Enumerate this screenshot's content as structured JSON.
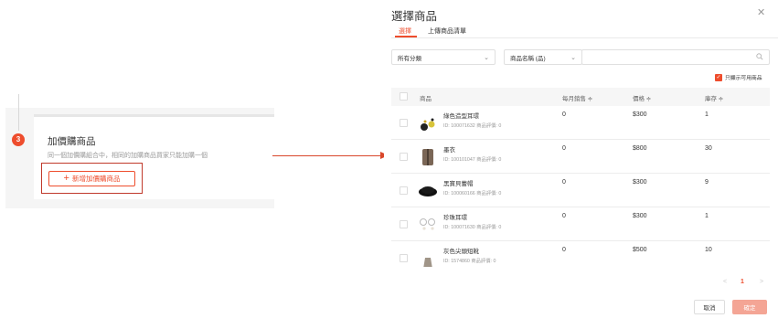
{
  "left_panel": {
    "step_number": "3",
    "title": "加價購商品",
    "description": "同一個加價購組合中，相同的加購商品買家只能加購一個",
    "add_button": {
      "icon": "plus-icon",
      "label": "新增加價購商品"
    }
  },
  "colors": {
    "accent": "#ee4d2d",
    "annotation": "#c0392b",
    "ok_disabled": "#f4a595"
  },
  "modal": {
    "title": "選擇商品",
    "close_icon": "close-icon",
    "tabs": [
      {
        "label": "選擇",
        "active": true
      },
      {
        "label": "上傳商品清單",
        "active": false
      }
    ],
    "filters": {
      "category": "所有分類",
      "search_field": "商品名稱 (品)",
      "search_icon": "search-icon"
    },
    "only_available": {
      "label": "只顯示可用商品",
      "checked": true
    },
    "table": {
      "headers": {
        "product": "商品",
        "monthly_sales": "每月銷售 ≑",
        "price": "價格 ≑",
        "stock": "庫存 ≑"
      },
      "rows": [
        {
          "name": "綠色造型耳環",
          "meta": "ID: 100071632   商品評價: 0",
          "monthly_sales": "0",
          "price": "$300",
          "stock": "1"
        },
        {
          "name": "墨衣",
          "meta": "ID: 100101047   商品評價: 0",
          "monthly_sales": "0",
          "price": "$800",
          "stock": "30"
        },
        {
          "name": "黑寶貝蕾帽",
          "meta": "ID: 100060166   商品評價: 0",
          "monthly_sales": "0",
          "price": "$300",
          "stock": "9"
        },
        {
          "name": "珍珠耳環",
          "meta": "ID: 100071630   商品評價: 0",
          "monthly_sales": "0",
          "price": "$300",
          "stock": "1"
        },
        {
          "name": "灰色尖頭短靴",
          "meta": "ID: 1574860   商品評價: 0",
          "monthly_sales": "0",
          "price": "$500",
          "stock": "10"
        }
      ]
    },
    "pagination": {
      "prev": "<",
      "current": "1",
      "next": ">"
    },
    "buttons": {
      "cancel": "取消",
      "confirm": "確定"
    }
  }
}
